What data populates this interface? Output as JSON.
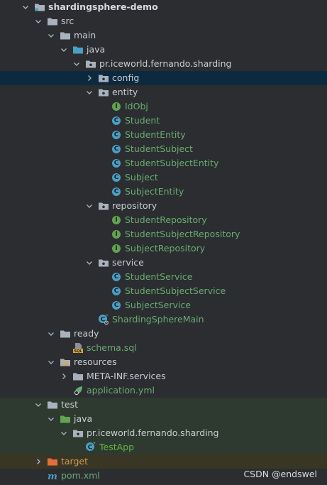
{
  "tree": {
    "rows": [
      {
        "label": "shardingsphere-demo",
        "indent": 0,
        "chevron": "down",
        "icon": "module-folder-icon",
        "style": "bold"
      },
      {
        "label": "src",
        "indent": 1,
        "chevron": "down",
        "icon": "folder-icon",
        "style": "normal"
      },
      {
        "label": "main",
        "indent": 2,
        "chevron": "down",
        "icon": "folder-icon",
        "style": "normal"
      },
      {
        "label": "java",
        "indent": 3,
        "chevron": "down",
        "icon": "source-folder-icon",
        "style": "normal"
      },
      {
        "label": "pr.iceworld.fernando.sharding",
        "indent": 4,
        "chevron": "down",
        "icon": "package-icon",
        "style": "normal"
      },
      {
        "label": "config",
        "indent": 5,
        "chevron": "right",
        "icon": "package-icon",
        "style": "normal",
        "selected": true
      },
      {
        "label": "entity",
        "indent": 5,
        "chevron": "down",
        "icon": "package-icon",
        "style": "normal"
      },
      {
        "label": "IdObj",
        "indent": 6,
        "chevron": "none",
        "icon": "interface-icon",
        "style": "green"
      },
      {
        "label": "Student",
        "indent": 6,
        "chevron": "none",
        "icon": "class-icon",
        "style": "green"
      },
      {
        "label": "StudentEntity",
        "indent": 6,
        "chevron": "none",
        "icon": "class-icon",
        "style": "green"
      },
      {
        "label": "StudentSubject",
        "indent": 6,
        "chevron": "none",
        "icon": "class-icon",
        "style": "green"
      },
      {
        "label": "StudentSubjectEntity",
        "indent": 6,
        "chevron": "none",
        "icon": "class-icon",
        "style": "green"
      },
      {
        "label": "Subject",
        "indent": 6,
        "chevron": "none",
        "icon": "class-icon",
        "style": "green"
      },
      {
        "label": "SubjectEntity",
        "indent": 6,
        "chevron": "none",
        "icon": "class-icon",
        "style": "green"
      },
      {
        "label": "repository",
        "indent": 5,
        "chevron": "down",
        "icon": "package-icon",
        "style": "normal"
      },
      {
        "label": "StudentRepository",
        "indent": 6,
        "chevron": "none",
        "icon": "interface-icon",
        "style": "green"
      },
      {
        "label": "StudentSubjectRepository",
        "indent": 6,
        "chevron": "none",
        "icon": "interface-icon",
        "style": "green"
      },
      {
        "label": "SubjectRepository",
        "indent": 6,
        "chevron": "none",
        "icon": "interface-icon",
        "style": "green"
      },
      {
        "label": "service",
        "indent": 5,
        "chevron": "down",
        "icon": "package-icon",
        "style": "normal"
      },
      {
        "label": "StudentService",
        "indent": 6,
        "chevron": "none",
        "icon": "class-icon",
        "style": "green"
      },
      {
        "label": "StudentSubjectService",
        "indent": 6,
        "chevron": "none",
        "icon": "class-icon",
        "style": "green"
      },
      {
        "label": "SubjectService",
        "indent": 6,
        "chevron": "none",
        "icon": "class-icon",
        "style": "green"
      },
      {
        "label": "ShardingSphereMain",
        "indent": 5,
        "chevron": "none",
        "icon": "spring-main-class-icon",
        "style": "green"
      },
      {
        "label": "ready",
        "indent": 2,
        "chevron": "down",
        "icon": "folder-icon",
        "style": "normal"
      },
      {
        "label": "schema.sql",
        "indent": 3,
        "chevron": "none",
        "icon": "sql-file-icon",
        "style": "green"
      },
      {
        "label": "resources",
        "indent": 2,
        "chevron": "down",
        "icon": "resources-folder-icon",
        "style": "normal"
      },
      {
        "label": "META-INF.services",
        "indent": 3,
        "chevron": "right",
        "icon": "folder-icon",
        "style": "normal"
      },
      {
        "label": "application.yml",
        "indent": 3,
        "chevron": "none",
        "icon": "spring-yml-icon",
        "style": "green"
      },
      {
        "label": "test",
        "indent": 1,
        "chevron": "down",
        "icon": "folder-icon",
        "style": "normal",
        "bg": "test"
      },
      {
        "label": "java",
        "indent": 2,
        "chevron": "down",
        "icon": "test-source-folder-icon",
        "style": "normal",
        "bg": "test"
      },
      {
        "label": "pr.iceworld.fernando.sharding",
        "indent": 3,
        "chevron": "down",
        "icon": "package-icon",
        "style": "normal",
        "bg": "test"
      },
      {
        "label": "TestApp",
        "indent": 4,
        "chevron": "none",
        "icon": "spring-test-class-icon",
        "style": "test-green",
        "bg": "test"
      },
      {
        "label": "target",
        "indent": 1,
        "chevron": "right",
        "icon": "excluded-folder-icon",
        "style": "olive",
        "bg": "target"
      },
      {
        "label": "pom.xml",
        "indent": 1,
        "chevron": "none",
        "icon": "maven-icon",
        "style": "green"
      }
    ]
  },
  "watermark": "CSDN @endswel",
  "colors": {
    "background": "#2b2d30",
    "selected": "#0d293e",
    "test_bg": "#2e3a30",
    "target_bg": "#3a3626",
    "class_badge": "#4a9fc5",
    "interface_badge": "#62a352",
    "green_text": "#6aab73",
    "olive_text": "#d19a54"
  }
}
